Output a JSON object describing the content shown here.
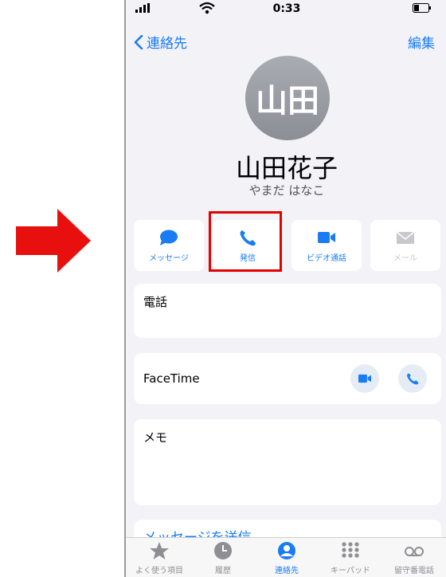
{
  "status_bar": {
    "time": "0:33"
  },
  "nav": {
    "back_label": "連絡先",
    "edit_label": "編集"
  },
  "contact": {
    "avatar_text": "山田",
    "name": "山田花子",
    "reading": "やまだ はなこ"
  },
  "actions": [
    {
      "label": "メッセージ",
      "icon": "message-icon"
    },
    {
      "label": "発信",
      "icon": "phone-icon"
    },
    {
      "label": "ビデオ通話",
      "icon": "video-icon"
    },
    {
      "label": "メール",
      "icon": "mail-icon",
      "disabled": true
    }
  ],
  "sections": {
    "phone_label": "電話",
    "facetime_label": "FaceTime",
    "memo_label": "メモ",
    "send_message_partial": "メッセージを送信"
  },
  "tabs": [
    {
      "label": "よく使う項目",
      "icon": "star-icon"
    },
    {
      "label": "履歴",
      "icon": "clock-icon"
    },
    {
      "label": "連絡先",
      "icon": "person-icon",
      "active": true
    },
    {
      "label": "キーパッド",
      "icon": "keypad-icon"
    },
    {
      "label": "留守番電話",
      "icon": "voicemail-icon"
    }
  ],
  "colors": {
    "accent": "#1a7cf5",
    "highlight": "#e30000",
    "background": "#f2f2f7"
  }
}
